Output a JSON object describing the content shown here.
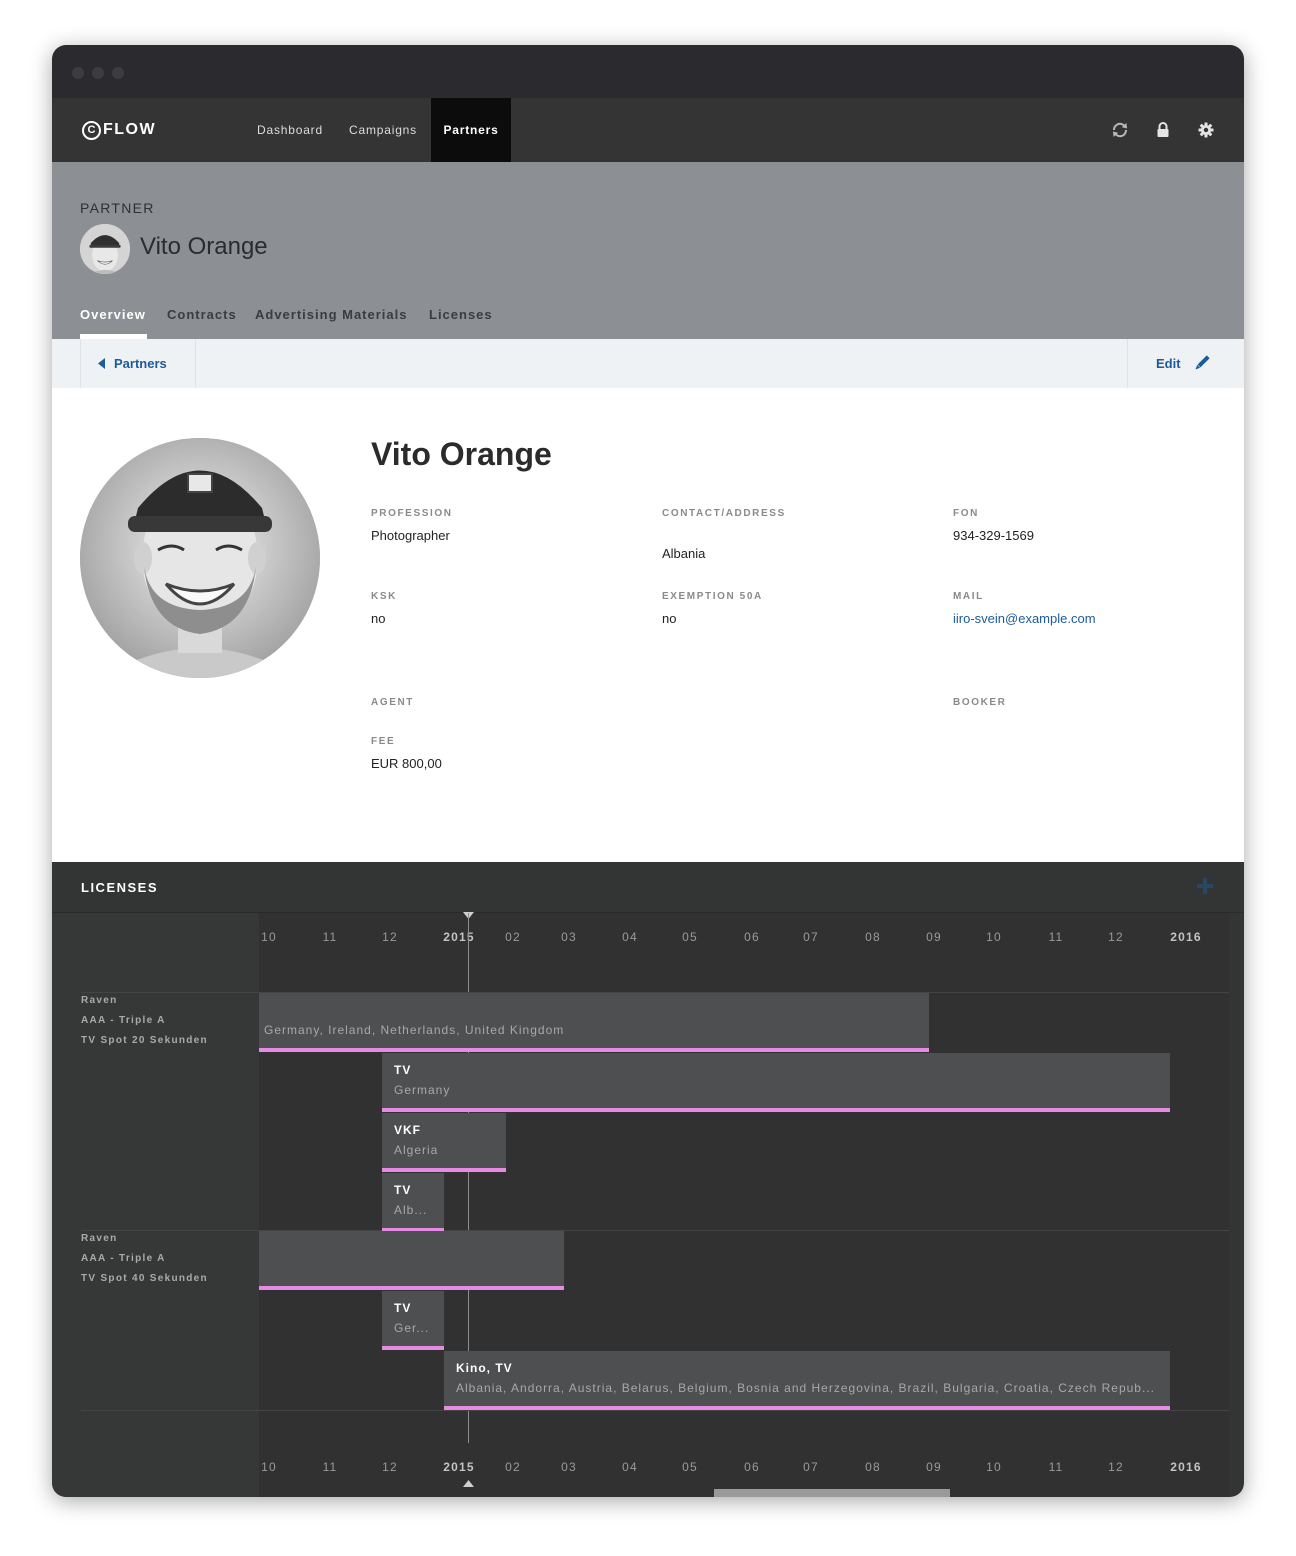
{
  "app": {
    "logo_c": "C",
    "logo_text": "FLOW"
  },
  "nav": [
    {
      "label": "Dashboard"
    },
    {
      "label": "Campaigns"
    },
    {
      "label": "Partners"
    }
  ],
  "icons": {
    "sync": "sync-icon",
    "lock": "lock-icon",
    "settings": "gear-icon",
    "back": "caret-left-icon",
    "edit": "pencil-icon",
    "add": "plus-icon"
  },
  "header": {
    "label": "PARTNER",
    "name": "Vito Orange",
    "tabs": [
      {
        "label": "Overview",
        "active": true
      },
      {
        "label": "Contracts"
      },
      {
        "label": "Advertising Materials"
      },
      {
        "label": "Licenses"
      }
    ]
  },
  "subbar": {
    "back_label": "Partners",
    "edit_label": "Edit"
  },
  "profile": {
    "name": "Vito Orange",
    "fields": {
      "profession": {
        "label": "PROFESSION",
        "value": "Photographer"
      },
      "contact": {
        "label": "CONTACT/ADDRESS",
        "value": "Albania"
      },
      "fon": {
        "label": "FON",
        "value": "934-329-1569"
      },
      "ksk": {
        "label": "KSK",
        "value": "no"
      },
      "exemption": {
        "label": "EXEMPTION 50A",
        "value": "no"
      },
      "mail": {
        "label": "MAIL",
        "value": "iiro-svein@example.com"
      },
      "agent": {
        "label": "AGENT"
      },
      "booker": {
        "label": "BOOKER"
      },
      "fee": {
        "label": "FEE",
        "value": "EUR 800,00"
      }
    }
  },
  "licenses": {
    "title": "LICENSES",
    "months": [
      "10",
      "11",
      "12",
      "2015",
      "02",
      "03",
      "04",
      "05",
      "06",
      "07",
      "08",
      "09",
      "10",
      "11",
      "12",
      "2016"
    ],
    "groups": [
      {
        "lines": [
          "Raven",
          "AAA - Triple A",
          "TV Spot 20 Sekunden"
        ],
        "bars": [
          {
            "title": "",
            "sub": "Germany, Ireland, Netherlands, United Kingdom"
          },
          {
            "title": "TV",
            "sub": "Germany"
          },
          {
            "title": "VKF",
            "sub": "Algeria"
          },
          {
            "title": "TV",
            "sub": "Alb..."
          }
        ]
      },
      {
        "lines": [
          "Raven",
          "AAA - Triple A",
          "TV Spot 40 Sekunden"
        ],
        "bars": [
          {
            "title": "",
            "sub": ""
          },
          {
            "title": "TV",
            "sub": "Ger..."
          },
          {
            "title": "Kino, TV",
            "sub": "Albania, Andorra, Austria, Belarus, Belgium, Bosnia and Herzegovina, Brazil, Bulgaria, Croatia, Czech Repub..."
          }
        ]
      }
    ]
  },
  "colors": {
    "accent": "#1d5b9a",
    "license_bar_border": "#e58be3",
    "nav_active": "#0c0c0c"
  }
}
